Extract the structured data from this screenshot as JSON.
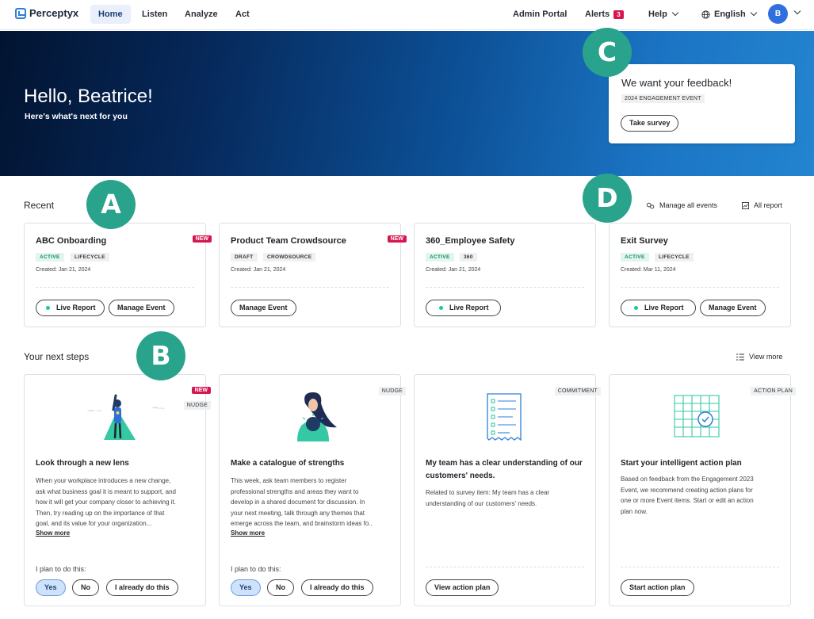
{
  "nav": {
    "brand": "Perceptyx",
    "tabs": [
      "Home",
      "Listen",
      "Analyze",
      "Act"
    ],
    "admin_portal": "Admin Portal",
    "alerts_label": "Alerts",
    "alerts_count": "3",
    "help_label": "Help",
    "language": "English",
    "avatar_initial": "B"
  },
  "hero": {
    "greeting": "Hello, Beatrice!",
    "subtitle": "Here's what's next for you",
    "feedback_title": "We want your feedback!",
    "feedback_tag": "2024 ENGAGEMENT EVENT",
    "take_survey": "Take survey"
  },
  "callouts": [
    "A",
    "B",
    "C",
    "D"
  ],
  "recent": {
    "title": "Recent",
    "manage_all": "Manage all events",
    "all_report": "All report",
    "cards": [
      {
        "title": "ABC Onboarding",
        "new": "NEW",
        "status": "ACTIVE",
        "type": "LIFECYCLE",
        "created": "Created: Jan 21, 2024",
        "live": "Live Report",
        "manage": "Manage Event"
      },
      {
        "title": "Product Team Crowdsource",
        "new": "NEW",
        "status": "DRAFT",
        "type": "CROWDSOURCE",
        "created": "Created: Jan 21, 2024",
        "manage": "Manage Event"
      },
      {
        "title": "360_Employee Safety",
        "status": "ACTIVE",
        "type": "360",
        "created": "Created: Jan 21, 2024",
        "live": "Live Report"
      },
      {
        "title": "Exit Survey",
        "status": "ACTIVE",
        "type": "LIFECYCLE",
        "created": "Created: Mar 11, 2024",
        "live": "Live Report",
        "manage": "Manage Event"
      }
    ]
  },
  "next_steps": {
    "title": "Your next steps",
    "view_more": "View more",
    "plan_label": "I plan to do this:",
    "yes": "Yes",
    "no": "No",
    "already": "I already do this",
    "show_more": "Show more",
    "cards": [
      {
        "type": "NUDGE",
        "new": "NEW",
        "title": "Look through a new lens",
        "lines": [
          "When your workplace introduces a new change,",
          "ask what business goal it is meant to support, and",
          "how it will get your company closer to achieving it.",
          "Then, try reading up on the importance of that",
          "goal, and its value for your organization..."
        ]
      },
      {
        "type": "NUDGE",
        "title": "Make a catalogue of strengths",
        "lines": [
          "This week, ask team members to register",
          "professional strengths and areas they want to",
          "develop in a shared document for discussion. In",
          "your next meeting, talk through any themes that",
          "emerge across the team, and brainstorm ideas fo.."
        ]
      },
      {
        "type": "COMMITMENT",
        "title_lines": [
          "My team has a clear understanding of our",
          "customers' needs."
        ],
        "lines": [
          "Related to survey item: My team has a clear",
          "understanding of our customers' needs."
        ],
        "action": "View action plan"
      },
      {
        "type": "ACTION PLAN",
        "title": "Start your intelligent action plan",
        "lines": [
          "Based on feedback from the Engagement 2023",
          "Event, we recommend creating action plans for",
          "one or more Event items. Start or edit an action",
          "plan now."
        ],
        "action": "Start action plan"
      }
    ]
  }
}
